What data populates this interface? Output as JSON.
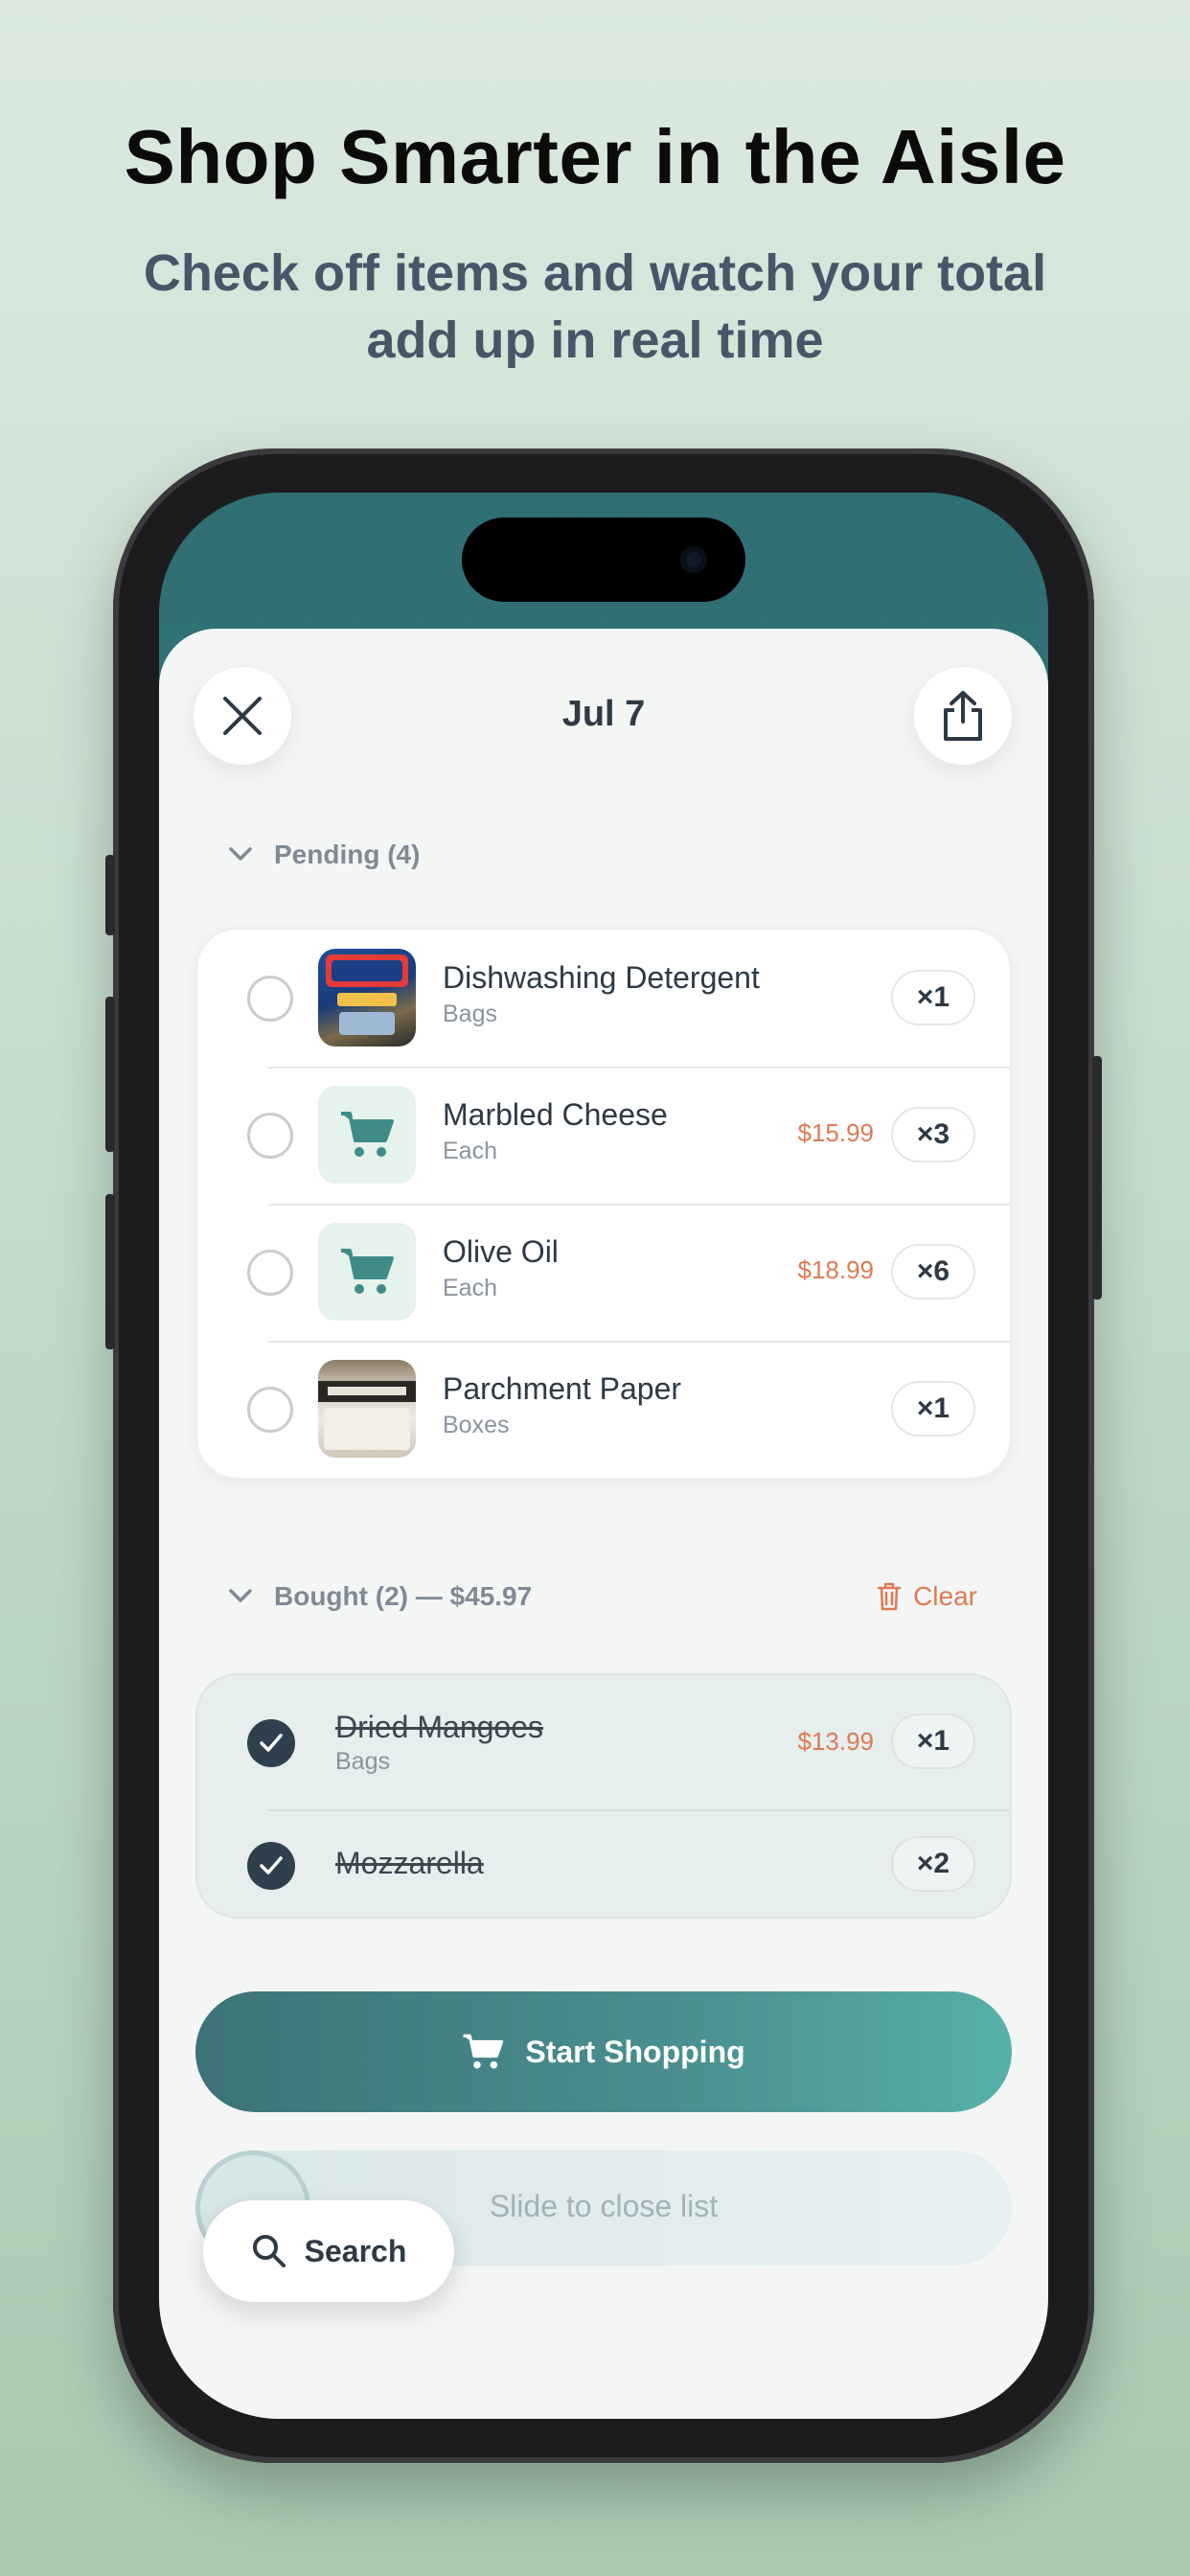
{
  "promo": {
    "headline": "Shop Smarter in the Aisle",
    "subline_1": "Check off items and watch your total",
    "subline_2": "add up in real time"
  },
  "header": {
    "title": "Jul 7",
    "close_icon": "close-icon",
    "share_icon": "share-icon"
  },
  "pending": {
    "label": "Pending (4)",
    "items": [
      {
        "name": "Dishwashing Detergent",
        "unit": "Bags",
        "price": "",
        "qty": "×1",
        "thumb": "detergent-photo"
      },
      {
        "name": "Marbled Cheese",
        "unit": "Each",
        "price": "$15.99",
        "qty": "×3",
        "thumb": "cart-icon"
      },
      {
        "name": "Olive Oil",
        "unit": "Each",
        "price": "$18.99",
        "qty": "×6",
        "thumb": "cart-icon"
      },
      {
        "name": "Parchment Paper",
        "unit": "Boxes",
        "price": "",
        "qty": "×1",
        "thumb": "parchment-photo"
      }
    ]
  },
  "bought": {
    "label": "Bought (2) — $45.97",
    "clear_label": "Clear",
    "items": [
      {
        "name": "Dried Mangoes",
        "unit": "Bags",
        "price": "$13.99",
        "qty": "×1"
      },
      {
        "name": "Mozzarella",
        "unit": "",
        "price": "",
        "qty": "×2"
      }
    ]
  },
  "actions": {
    "start_label": "Start Shopping",
    "slide_label": "Slide to close list",
    "search_label": "Search"
  },
  "colors": {
    "accent": "#4a9090",
    "price": "#df7a52",
    "check": "#2f3f4d"
  }
}
